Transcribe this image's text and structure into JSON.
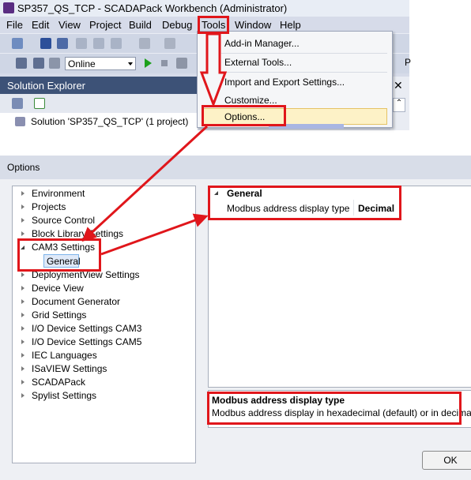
{
  "window": {
    "title": "SP357_QS_TCP - SCADAPack Workbench (Administrator)"
  },
  "menubar": {
    "items": [
      "File",
      "Edit",
      "View",
      "Project",
      "Build",
      "Debug",
      "Tools",
      "Window",
      "Help"
    ]
  },
  "toolbar": {
    "mode_select_value": "Online",
    "partial_label": "P"
  },
  "solution_explorer": {
    "header": "Solution Explorer",
    "close_glyph": "✕",
    "collapse_glyph": "⌃",
    "root_item": "Solution 'SP357_QS_TCP' (1 project)"
  },
  "tools_menu": {
    "items": [
      "Add-in Manager...",
      "External Tools...",
      "Import and Export Settings...",
      "Customize...",
      "Options..."
    ]
  },
  "options_dialog": {
    "title": "Options",
    "tree": [
      "Environment",
      "Projects",
      "Source Control",
      "Block Library Settings",
      "CAM3 Settings",
      "General",
      "DeploymentView Settings",
      "Device View",
      "Document Generator",
      "Grid Settings",
      "I/O Device Settings CAM3",
      "I/O Device Settings CAM5",
      "IEC Languages",
      "ISaVIEW Settings",
      "SCADAPack",
      "Spylist Settings"
    ],
    "property_grid": {
      "category": "General",
      "property_name": "Modbus address display type",
      "property_value": "Decimal"
    },
    "description": {
      "title": "Modbus address display type",
      "text": "Modbus address display in hexadecimal (default) or in decimal"
    },
    "ok_label": "OK"
  },
  "colors": {
    "annotation_red": "#e0161b",
    "header_navy": "#3d5277",
    "highlight_yellow": "#fdf2c7"
  }
}
